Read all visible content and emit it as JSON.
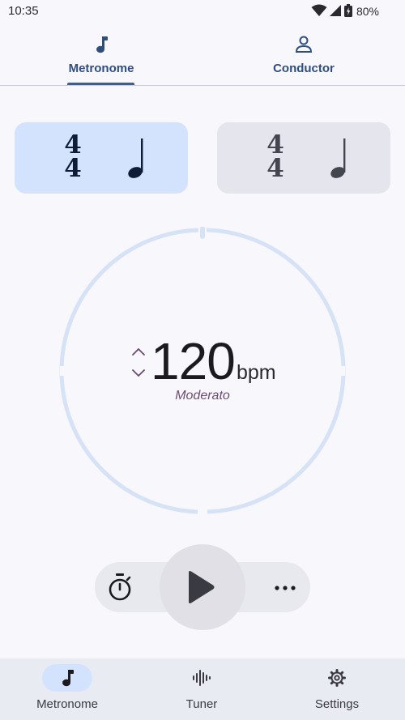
{
  "status_bar": {
    "time": "10:35",
    "battery": "80%"
  },
  "top_tabs": [
    {
      "label": "Metronome",
      "selected": true,
      "icon": "music-note-icon"
    },
    {
      "label": "Conductor",
      "selected": false,
      "icon": "person-icon"
    }
  ],
  "presets": [
    {
      "numerator": "4",
      "denominator": "4",
      "beat": "quarter-note-icon",
      "selected": true
    },
    {
      "numerator": "4",
      "denominator": "4",
      "beat": "quarter-note-icon",
      "selected": false
    }
  ],
  "tempo": {
    "value": "120",
    "unit": "bpm",
    "marking": "Moderato"
  },
  "controls": {
    "timer": "timer-icon",
    "play": "play-icon",
    "more": "more-icon"
  },
  "bottom_nav": [
    {
      "label": "Metronome",
      "selected": true,
      "icon": "music-note-icon"
    },
    {
      "label": "Tuner",
      "selected": false,
      "icon": "waveform-icon"
    },
    {
      "label": "Settings",
      "selected": false,
      "icon": "gear-icon"
    }
  ],
  "colors": {
    "accent": "#3D5F94",
    "selected_card": "#D4E3FD",
    "unselected_card": "#E5E5EE",
    "dial_ring": "#D6E2F5",
    "marking": "#6A4C77",
    "background": "#F8F7FC"
  }
}
